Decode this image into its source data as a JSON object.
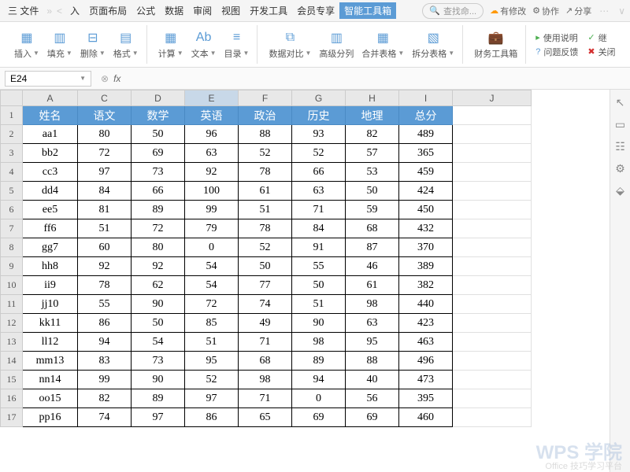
{
  "menubar": {
    "file": "三 文件",
    "sep": "»",
    "tabs": [
      "入",
      "页面布局",
      "公式",
      "数据",
      "审阅",
      "视图",
      "开发工具",
      "会员专享",
      "智能工具箱"
    ],
    "active_index": 8,
    "search_placeholder": "查找命...",
    "right": {
      "unsaved": "有修改",
      "collab": "协作",
      "share": "分享"
    }
  },
  "toolbar": {
    "insert": "插入",
    "fill": "填充",
    "delete": "删除",
    "format": "格式",
    "calc": "计算",
    "text": "文本",
    "toc": "目录",
    "datacompare": "数据对比",
    "advsplit": "高级分列",
    "merge": "合并表格",
    "split": "拆分表格",
    "finance": "财务工具箱",
    "help": "使用说明",
    "cont": "继",
    "feedback": "问题反馈",
    "close": "关闭"
  },
  "namebox": "E24",
  "fx_label": "fx",
  "columns": [
    "A",
    "C",
    "D",
    "E",
    "F",
    "G",
    "H",
    "I",
    "J"
  ],
  "selected_col": "E",
  "headers": [
    "姓名",
    "语文",
    "数学",
    "英语",
    "政治",
    "历史",
    "地理",
    "总分"
  ],
  "chart_data": {
    "type": "table",
    "columns": [
      "姓名",
      "语文",
      "数学",
      "英语",
      "政治",
      "历史",
      "地理",
      "总分"
    ],
    "rows": [
      [
        "aa1",
        80,
        50,
        96,
        88,
        93,
        82,
        489
      ],
      [
        "bb2",
        72,
        69,
        63,
        52,
        52,
        57,
        365
      ],
      [
        "cc3",
        97,
        73,
        92,
        78,
        66,
        53,
        459
      ],
      [
        "dd4",
        84,
        66,
        100,
        61,
        63,
        50,
        424
      ],
      [
        "ee5",
        81,
        89,
        99,
        51,
        71,
        59,
        450
      ],
      [
        "ff6",
        51,
        72,
        79,
        78,
        84,
        68,
        432
      ],
      [
        "gg7",
        60,
        80,
        0,
        52,
        91,
        87,
        370
      ],
      [
        "hh8",
        92,
        92,
        54,
        50,
        55,
        46,
        389
      ],
      [
        "ii9",
        78,
        62,
        54,
        77,
        50,
        61,
        382
      ],
      [
        "jj10",
        55,
        90,
        72,
        74,
        51,
        98,
        440
      ],
      [
        "kk11",
        86,
        50,
        85,
        49,
        90,
        63,
        423
      ],
      [
        "ll12",
        94,
        54,
        51,
        71,
        98,
        95,
        463
      ],
      [
        "mm13",
        83,
        73,
        95,
        68,
        89,
        88,
        496
      ],
      [
        "nn14",
        99,
        90,
        52,
        98,
        94,
        40,
        473
      ],
      [
        "oo15",
        82,
        89,
        97,
        71,
        0,
        56,
        395
      ],
      [
        "pp16",
        74,
        97,
        86,
        65,
        69,
        69,
        460
      ]
    ]
  },
  "watermark": "WPS 学院",
  "watermark_sub": "Office 技巧学习平台"
}
